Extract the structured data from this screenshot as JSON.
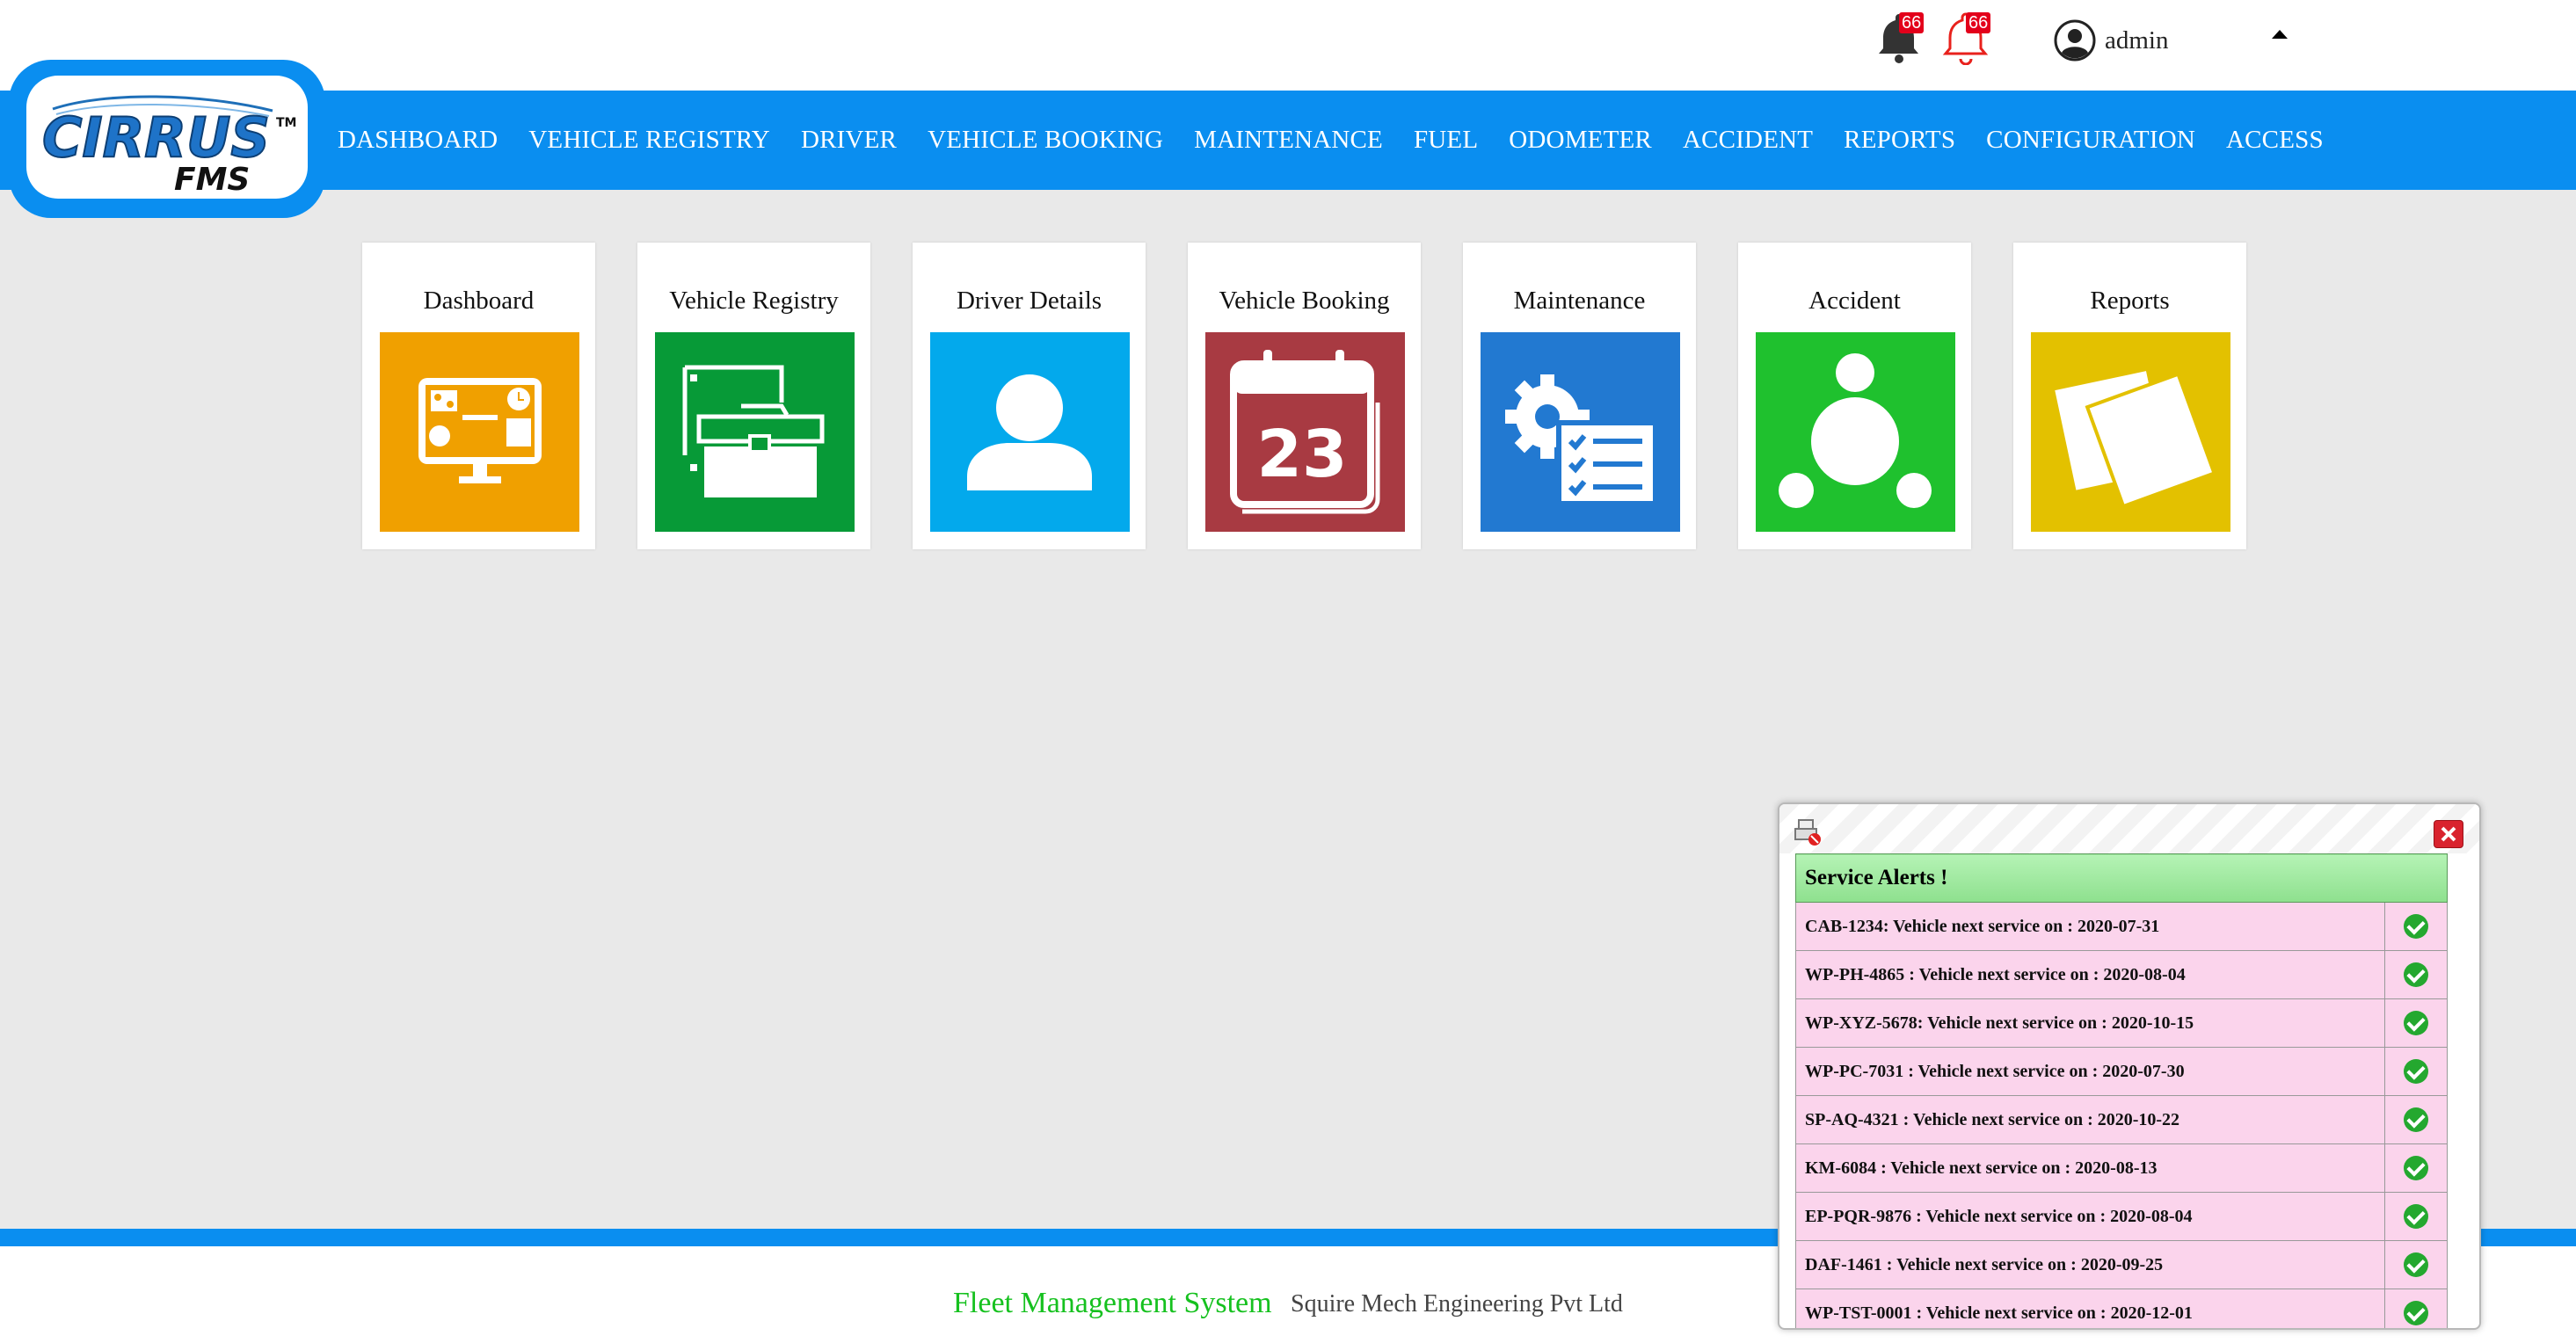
{
  "header": {
    "notifications": [
      {
        "icon": "bell-filled-icon",
        "count": "66"
      },
      {
        "icon": "bell-outline-icon",
        "count": "66"
      }
    ],
    "user": {
      "name": "admin",
      "icon": "user-avatar-icon"
    }
  },
  "brand": {
    "logo_text": "CIRRUS",
    "logo_sub": "FMS",
    "logo_tm": "TM"
  },
  "nav": {
    "items": [
      "DASHBOARD",
      "VEHICLE REGISTRY",
      "DRIVER",
      "VEHICLE BOOKING",
      "MAINTENANCE",
      "FUEL",
      "ODOMETER",
      "ACCIDENT",
      "REPORTS",
      "CONFIGURATION",
      "ACCESS"
    ]
  },
  "tiles": [
    {
      "label": "Dashboard",
      "color": "#f0a000",
      "icon": "monitor-dashboard-icon"
    },
    {
      "label": "Vehicle Registry",
      "color": "#079a37",
      "icon": "toolbox-icon"
    },
    {
      "label": "Driver Details",
      "color": "#03a9ec",
      "icon": "person-icon"
    },
    {
      "label": "Vehicle Booking",
      "color": "#a83a42",
      "icon": "calendar-icon",
      "calendar_day": "23"
    },
    {
      "label": "Maintenance",
      "color": "#2279d1",
      "icon": "gear-checklist-icon"
    },
    {
      "label": "Accident",
      "color": "#1fc12e",
      "icon": "circles-network-icon"
    },
    {
      "label": "Reports",
      "color": "#e3c100",
      "icon": "notes-icon"
    }
  ],
  "alerts": {
    "title": "Service Alerts !",
    "items": [
      "CAB-1234: Vehicle next service on : 2020-07-31",
      "WP-PH-4865 : Vehicle next service on : 2020-08-04",
      "WP-XYZ-5678: Vehicle next service on : 2020-10-15",
      "WP-PC-7031 : Vehicle next service on : 2020-07-30",
      "SP-AQ-4321 : Vehicle next service on : 2020-10-22",
      "KM-6084 : Vehicle next service on : 2020-08-13",
      "EP-PQR-9876 : Vehicle next service on : 2020-08-04",
      "DAF-1461 : Vehicle next service on : 2020-09-25",
      "WP-TST-0001 : Vehicle next service on : 2020-12-01"
    ]
  },
  "footer": {
    "system": "Fleet Management System",
    "company": "Squire Mech Engineering Pvt Ltd"
  }
}
